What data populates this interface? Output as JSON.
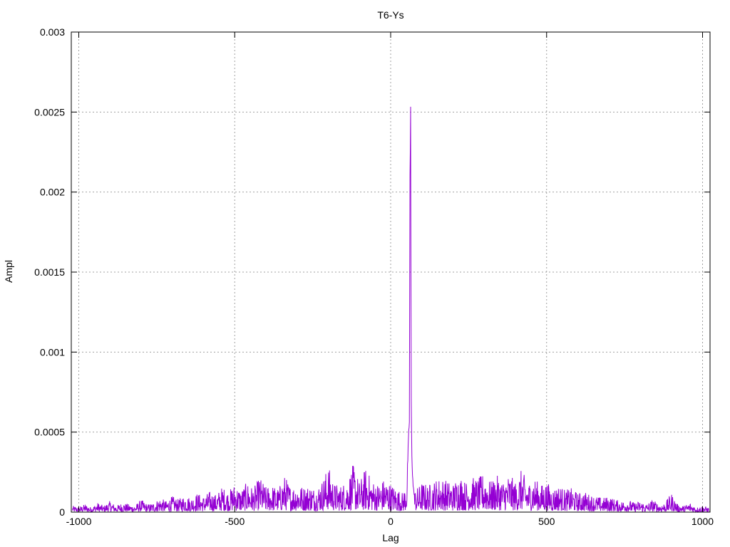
{
  "chart_data": {
    "type": "line",
    "title": "T6-Ys",
    "xlabel": "Lag",
    "ylabel": "Ampl",
    "xlim": [
      -1024,
      1024
    ],
    "ylim": [
      0,
      0.003
    ],
    "grid": true,
    "line_color": "#9400d3",
    "x_ticks": [
      {
        "value": -1000,
        "label": "-1000"
      },
      {
        "value": -500,
        "label": "-500"
      },
      {
        "value": 0,
        "label": "0"
      },
      {
        "value": 500,
        "label": "500"
      },
      {
        "value": 1000,
        "label": "1000"
      }
    ],
    "y_ticks": [
      {
        "value": 0,
        "label": "0"
      },
      {
        "value": 0.0005,
        "label": "0.0005"
      },
      {
        "value": 0.001,
        "label": "0.001"
      },
      {
        "value": 0.0015,
        "label": "0.0015"
      },
      {
        "value": 0.002,
        "label": "0.002"
      },
      {
        "value": 0.0025,
        "label": "0.0025"
      },
      {
        "value": 0.003,
        "label": "0.003"
      }
    ],
    "series": [
      {
        "x": [
          -1020,
          -1000,
          -980,
          -960,
          -940,
          -920,
          -900,
          -880,
          -860,
          -840,
          -820,
          -800,
          -780,
          -760,
          -740,
          -720,
          -700,
          -680,
          -660,
          -640,
          -620,
          -600,
          -580,
          -560,
          -540,
          -520,
          -500,
          -480,
          -460,
          -440,
          -420,
          -400,
          -380,
          -360,
          -340,
          -320,
          -300,
          -280,
          -260,
          -240,
          -220,
          -200,
          -180,
          -160,
          -140,
          -120,
          -100,
          -80,
          -60,
          -40,
          -20,
          0,
          20,
          40,
          50,
          55,
          60,
          62,
          64,
          66,
          68,
          70,
          72,
          74,
          76,
          80,
          90,
          100,
          120,
          140,
          160,
          180,
          200,
          220,
          240,
          260,
          280,
          300,
          320,
          340,
          360,
          380,
          400,
          420,
          440,
          460,
          480,
          500,
          520,
          540,
          560,
          580,
          600,
          620,
          640,
          660,
          680,
          700,
          720,
          740,
          760,
          780,
          800,
          820,
          840,
          860,
          880,
          900,
          920,
          940,
          960,
          980,
          1000,
          1020
        ],
        "y": [
          4e-05,
          3e-05,
          5e-05,
          3e-05,
          6e-05,
          4e-05,
          7e-05,
          4e-05,
          6e-05,
          5e-05,
          4e-05,
          8e-05,
          5e-05,
          6e-05,
          9e-05,
          7e-05,
          0.0001,
          8e-05,
          0.00011,
          9e-05,
          0.00012,
          0.0001,
          0.00013,
          0.00011,
          0.00016,
          0.00013,
          0.00018,
          0.00014,
          0.00019,
          0.00015,
          0.00022,
          0.00016,
          0.00017,
          0.00015,
          0.00023,
          0.00016,
          0.00018,
          0.00016,
          0.00017,
          0.00015,
          0.0002,
          0.00029,
          0.00018,
          0.00017,
          0.0002,
          0.0003,
          0.00019,
          0.00028,
          0.0002,
          0.00018,
          0.00021,
          0.00018,
          0.00015,
          0.00012,
          0.0002,
          0.00036,
          0.00063,
          0.0023,
          0.00258,
          0.00072,
          0.0004,
          0.00025,
          0.00018,
          0.00014,
          0.00012,
          0.00015,
          0.00016,
          0.00019,
          0.00017,
          0.0002,
          0.00022,
          0.0002,
          0.00018,
          0.00024,
          0.00019,
          0.00022,
          0.00021,
          0.00025,
          0.00019,
          0.00023,
          0.0002,
          0.00024,
          0.00019,
          0.00027,
          0.00018,
          0.00022,
          0.00017,
          0.00019,
          0.00015,
          0.00017,
          0.00014,
          0.00015,
          0.00012,
          0.00013,
          0.00011,
          0.0001,
          9e-05,
          0.0001,
          8e-05,
          7e-05,
          8e-05,
          6e-05,
          7e-05,
          5e-05,
          8e-05,
          5e-05,
          6e-05,
          0.00012,
          5e-05,
          4e-05,
          6e-05,
          3e-05,
          4e-05,
          3e-05
        ]
      }
    ]
  }
}
